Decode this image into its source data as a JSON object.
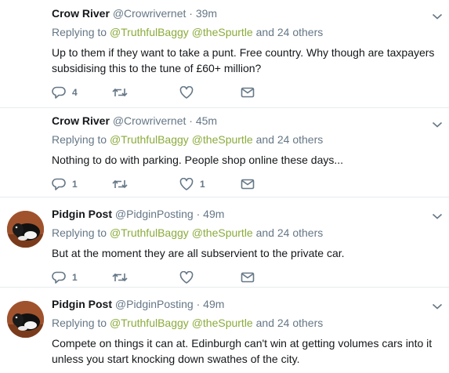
{
  "tweets": [
    {
      "name": "Crow River",
      "handle": "@Crowrivernet",
      "separator": "·",
      "time": "39m",
      "replying_prefix": "Replying to",
      "mention1": "@TruthfulBaggy",
      "mention2": "@theSpurtle",
      "replying_suffix": "and 24 others",
      "text": "Up to them if they want to take a punt. Free country. Why though are taxpayers subsidising this to the tune of £60+ million?",
      "replies": "4",
      "retweets": "",
      "likes": ""
    },
    {
      "name": "Crow River",
      "handle": "@Crowrivernet",
      "separator": "·",
      "time": "45m",
      "replying_prefix": "Replying to",
      "mention1": "@TruthfulBaggy",
      "mention2": "@theSpurtle",
      "replying_suffix": "and 24 others",
      "text": "Nothing to do with parking. People shop online these days...",
      "replies": "1",
      "retweets": "",
      "likes": "1"
    },
    {
      "name": "Pidgin Post",
      "handle": "@PidginPosting",
      "separator": "·",
      "time": "49m",
      "replying_prefix": "Replying to",
      "mention1": "@TruthfulBaggy",
      "mention2": "@theSpurtle",
      "replying_suffix": "and 24 others",
      "text": "But at the moment they are all subservient to the private car.",
      "replies": "1",
      "retweets": "",
      "likes": ""
    },
    {
      "name": "Pidgin Post",
      "handle": "@PidginPosting",
      "separator": "·",
      "time": "49m",
      "replying_prefix": "Replying to",
      "mention1": "@TruthfulBaggy",
      "mention2": "@theSpurtle",
      "replying_suffix": "and 24 others",
      "text": "Compete on things it can at. Edinburgh can't win at getting volumes cars into it unless you start knocking down swathes of the city."
    }
  ],
  "icons": {
    "reply": "reply-icon",
    "retweet": "retweet-icon",
    "like": "heart-icon",
    "dm": "envelope-icon",
    "caret": "chevron-down-icon",
    "avatar": "dog-avatar"
  },
  "colors": {
    "text": "#14171a",
    "muted": "#657786",
    "mention": "#8bab3b",
    "divider": "#e6ecf0"
  }
}
